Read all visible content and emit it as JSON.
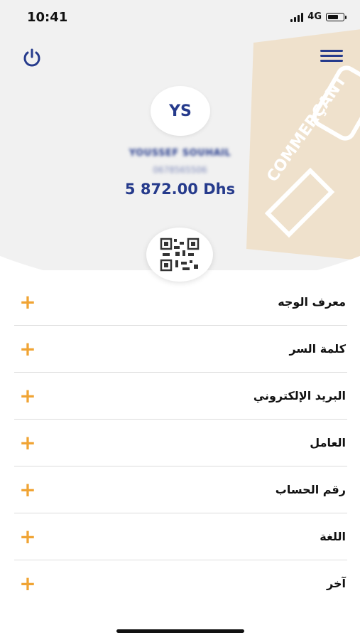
{
  "status_bar": {
    "time": "10:41",
    "network": "4G"
  },
  "profile": {
    "initials": "YS",
    "name": "YOUSSEF SOUHAIL",
    "phone": "0678565506",
    "balance": "5 872.00 Dhs"
  },
  "watermark": {
    "text": "COMMERÇANT"
  },
  "settings": [
    {
      "label": "معرف الوجه"
    },
    {
      "label": "كلمة السر"
    },
    {
      "label": "البريد الإلكتروني"
    },
    {
      "label": "العامل"
    },
    {
      "label": "رقم الحساب"
    },
    {
      "label": "اللغة"
    },
    {
      "label": "آخر"
    }
  ],
  "colors": {
    "brand": "#263b8c",
    "accent": "#f0a434",
    "background": "#f1f1f1"
  },
  "icons": {
    "power": "power-icon",
    "menu": "hamburger-menu-icon",
    "qr": "qr-code-icon",
    "expand": "plus-icon"
  }
}
